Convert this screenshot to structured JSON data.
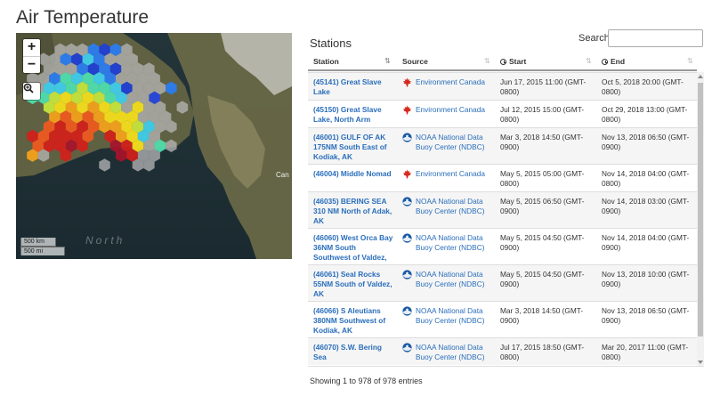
{
  "page": {
    "title": "Air Temperature"
  },
  "map": {
    "zoom_in": "+",
    "zoom_out": "−",
    "scale_km": "500 km",
    "scale_mi": "500 mi",
    "region_label": "North",
    "edge_label": "Can"
  },
  "stations_panel": {
    "title": "Stations",
    "search_label": "Search:",
    "search_value": "",
    "columns": {
      "station": "Station",
      "source": "Source",
      "start": "Start",
      "end": "End"
    },
    "rows": [
      {
        "station": "(45141) Great Slave Lake",
        "source": "Environment Canada",
        "source_icon": "maple-leaf-icon",
        "start": "Jun 17, 2015 11:00 (GMT-0800)",
        "end": "Oct 5, 2018 20:00 (GMT-0800)"
      },
      {
        "station": "(45150) Great Slave Lake, North Arm",
        "source": "Environment Canada",
        "source_icon": "maple-leaf-icon",
        "start": "Jul 12, 2015 15:00 (GMT-0800)",
        "end": "Oct 29, 2018 13:00 (GMT-0800)"
      },
      {
        "station": "(46001) GULF OF AK 175NM South East of Kodiak, AK",
        "source": "NOAA National Data Buoy Center (NDBC)",
        "source_icon": "noaa-logo-icon",
        "start": "Mar 3, 2018 14:50 (GMT-0900)",
        "end": "Nov 13, 2018 06:50 (GMT-0900)"
      },
      {
        "station": "(46004) Middle Nomad",
        "source": "Environment Canada",
        "source_icon": "maple-leaf-icon",
        "start": "May 5, 2015 05:00 (GMT-0800)",
        "end": "Nov 14, 2018 04:00 (GMT-0800)"
      },
      {
        "station": "(46035) BERING SEA 310 NM North of Adak, AK",
        "source": "NOAA National Data Buoy Center (NDBC)",
        "source_icon": "noaa-logo-icon",
        "start": "May 5, 2015 06:50 (GMT-0900)",
        "end": "Nov 14, 2018 03:00 (GMT-0900)"
      },
      {
        "station": "(46060) West Orca Bay 36NM South Southwest of Valdez, AK",
        "source": "NOAA National Data Buoy Center (NDBC)",
        "source_icon": "noaa-logo-icon",
        "start": "May 5, 2015 04:50 (GMT-0900)",
        "end": "Nov 14, 2018 04:00 (GMT-0900)"
      },
      {
        "station": "(46061) Seal Rocks 55NM South of Valdez, AK",
        "source": "NOAA National Data Buoy Center (NDBC)",
        "source_icon": "noaa-logo-icon",
        "start": "May 5, 2015 04:50 (GMT-0900)",
        "end": "Nov 13, 2018 10:00 (GMT-0900)"
      },
      {
        "station": "(46066) S Aleutians 380NM Southwest of Kodiak, AK",
        "source": "NOAA National Data Buoy Center (NDBC)",
        "source_icon": "noaa-logo-icon",
        "start": "Mar 3, 2018 14:50 (GMT-0900)",
        "end": "Nov 13, 2018 06:50 (GMT-0900)"
      },
      {
        "station": "(46070) S.W. Bering Sea",
        "source": "NOAA National Data Buoy Center (NDBC)",
        "source_icon": "noaa-logo-icon",
        "start": "Jul 17, 2015 18:50 (GMT-0800)",
        "end": "Mar 20, 2017 11:00 (GMT-0800)"
      }
    ],
    "footer": "Showing 1 to 978 of 978 entries"
  },
  "colors": {
    "link": "#2a6ebb",
    "hex_palette": [
      "#1e3fd8",
      "#2a7ef5",
      "#3fd0ef",
      "#4ee2b0",
      "#c8e83c",
      "#f7e21a",
      "#f7a41a",
      "#f25a1e",
      "#d4201a",
      "#a8122a",
      "#b8b8b8"
    ]
  }
}
